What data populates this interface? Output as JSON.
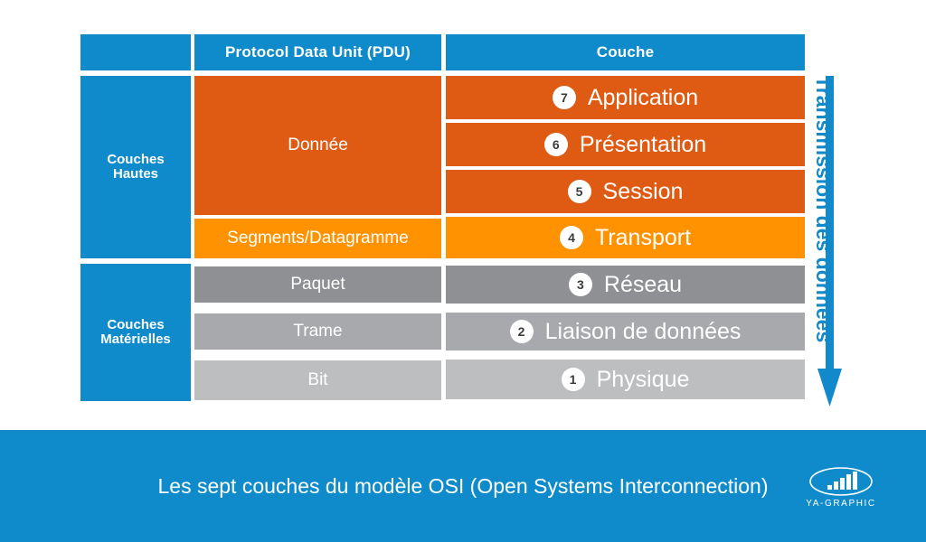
{
  "colors": {
    "blue": "#0F8BCB",
    "dark_orange": "#DF5B14",
    "bright_orange": "#FF9200",
    "gray_1": "#8E9093",
    "gray_2": "#A7A9AC",
    "gray_3": "#BCBEC0",
    "white": "#FFFFFF",
    "number_text": "#3B3B3B"
  },
  "table": {
    "headers": {
      "corner": "",
      "pdu": "Protocol Data Unit (PDU)",
      "layer": "Couche"
    },
    "groups": [
      {
        "label_line1": "Couches",
        "label_line2": "Hautes"
      },
      {
        "label_line1": "Couches",
        "label_line2": "Matérielles"
      }
    ],
    "pdu_cells": [
      {
        "text": "Donnée",
        "color": "#DF5B14"
      },
      {
        "text": "Segments/Datagramme",
        "color": "#FF9200"
      },
      {
        "text": "Paquet",
        "color": "#8E9093"
      },
      {
        "text": "Trame",
        "color": "#A7A9AC"
      },
      {
        "text": "Bit",
        "color": "#BCBEC0"
      }
    ],
    "layers": [
      {
        "number": "7",
        "name": "Application",
        "color": "#DF5B14"
      },
      {
        "number": "6",
        "name": "Présentation",
        "color": "#DF5B14"
      },
      {
        "number": "5",
        "name": "Session",
        "color": "#DF5B14"
      },
      {
        "number": "4",
        "name": "Transport",
        "color": "#FF9200"
      },
      {
        "number": "3",
        "name": "Réseau",
        "color": "#8E9093"
      },
      {
        "number": "2",
        "name": "Liaison de données",
        "color": "#A7A9AC"
      },
      {
        "number": "1",
        "name": "Physique",
        "color": "#BCBEC0"
      }
    ]
  },
  "arrow": {
    "label": "Transmission des données",
    "direction": "down",
    "color": "#1189CA"
  },
  "footer": {
    "caption": "Les sept couches du modèle OSI (Open Systems Interconnection)",
    "logo_text": "YA-GRAPHIC"
  }
}
